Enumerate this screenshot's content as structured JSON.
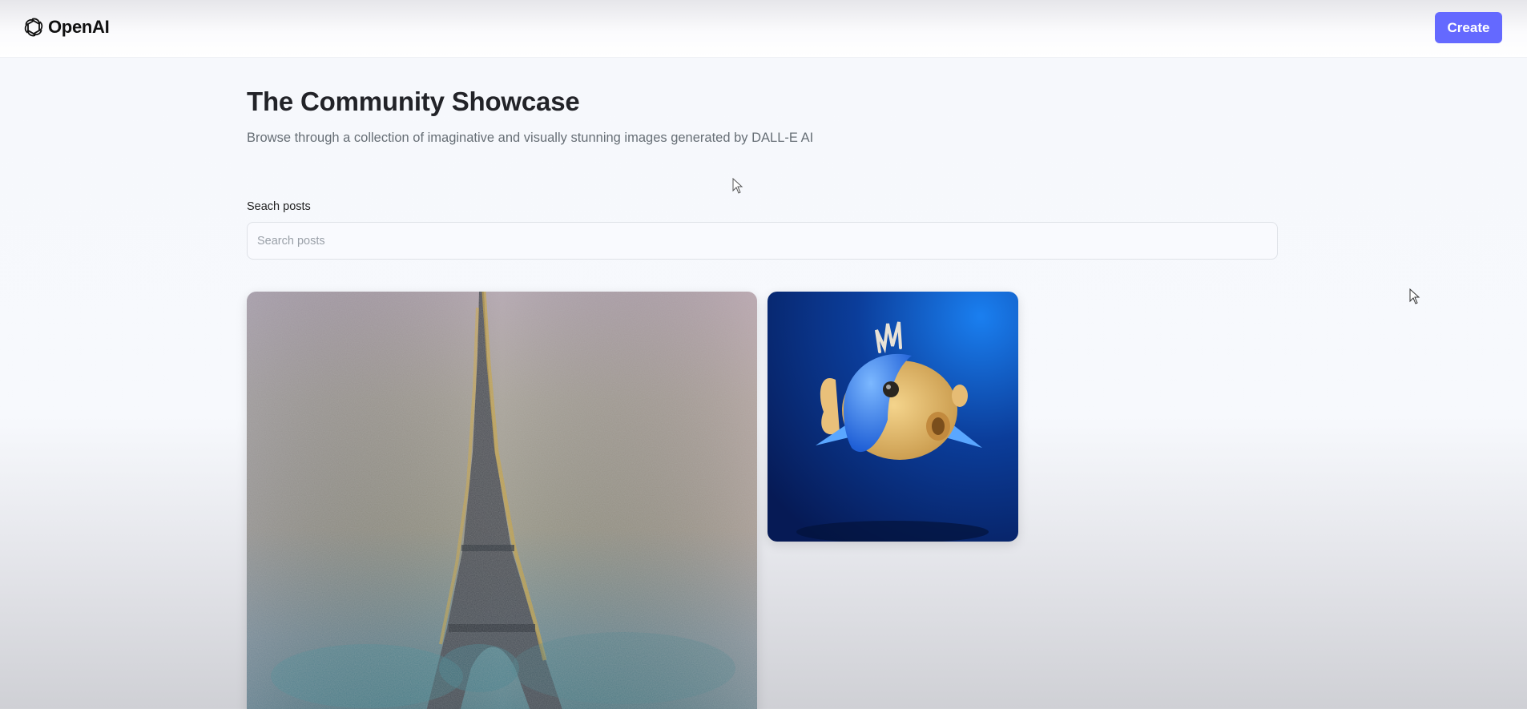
{
  "header": {
    "logo_text": "OpenAI",
    "logo_icon": "openai-logo-icon",
    "create_label": "Create"
  },
  "main": {
    "title": "The Community Showcase",
    "subtitle": "Browse through a collection of imaginative and visually stunning images generated by DALL-E AI",
    "search": {
      "label": "Seach posts",
      "placeholder": "Search posts",
      "value": ""
    }
  },
  "gallery": [
    {
      "name": "eiffel-tower-painting",
      "alt": "Impressionist painting of the Eiffel Tower"
    },
    {
      "name": "3d-blue-fish",
      "alt": "3D render of a blue and yellow fish"
    }
  ],
  "colors": {
    "accent": "#6469ff",
    "title": "#222328",
    "subtitle": "#666e75"
  }
}
